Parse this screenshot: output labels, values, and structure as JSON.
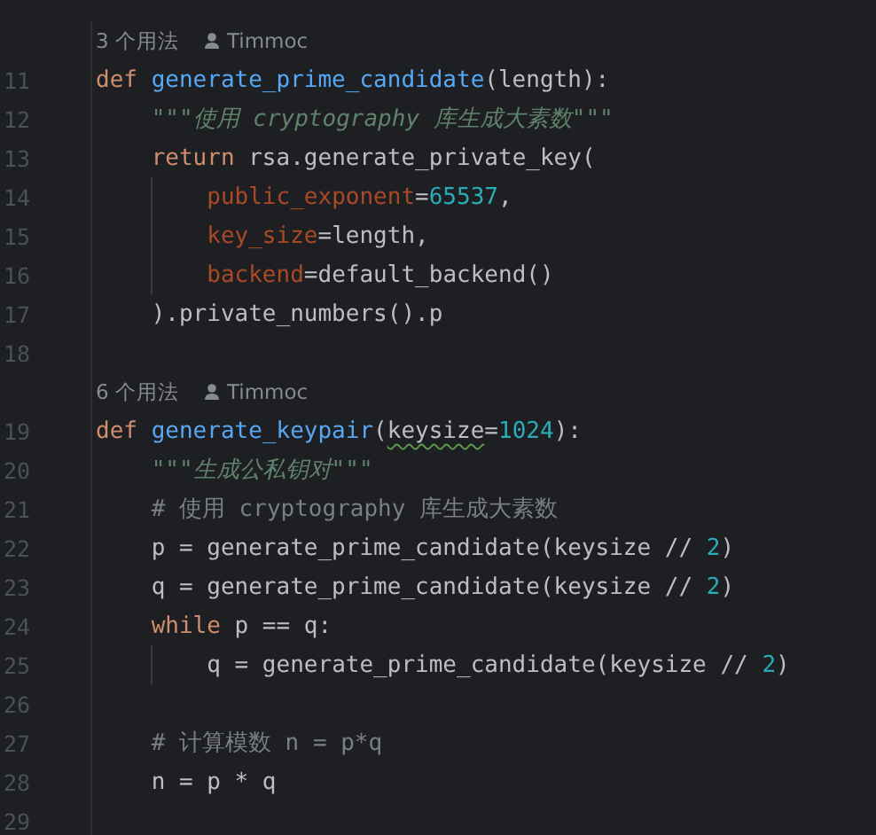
{
  "editor": {
    "rows": [
      {
        "kind": "hint",
        "usages": "3 个用法",
        "author": "Timmoc"
      },
      {
        "kind": "code",
        "number": "11",
        "tokens": [
          {
            "kind": "keyword",
            "text": "def "
          },
          {
            "kind": "function",
            "text": "generate_prime_candidate"
          },
          {
            "kind": "plain",
            "text": "(length):"
          }
        ]
      },
      {
        "kind": "code",
        "number": "12",
        "tokens": [
          {
            "kind": "docstring",
            "text": "    \"\"\"使用 cryptography 库生成大素数\"\"\""
          }
        ]
      },
      {
        "kind": "code",
        "number": "13",
        "tokens": [
          {
            "kind": "keyword",
            "text": "    return "
          },
          {
            "kind": "plain",
            "text": "rsa.generate_private_key("
          }
        ]
      },
      {
        "kind": "code",
        "number": "14",
        "tokens": [
          {
            "kind": "named-arg",
            "text": "        public_exponent"
          },
          {
            "kind": "plain",
            "text": "="
          },
          {
            "kind": "number",
            "text": "65537"
          },
          {
            "kind": "plain",
            "text": ","
          }
        ]
      },
      {
        "kind": "code",
        "number": "15",
        "tokens": [
          {
            "kind": "named-arg",
            "text": "        key_size"
          },
          {
            "kind": "plain",
            "text": "=length,"
          }
        ]
      },
      {
        "kind": "code",
        "number": "16",
        "tokens": [
          {
            "kind": "named-arg",
            "text": "        backend"
          },
          {
            "kind": "plain",
            "text": "=default_backend()"
          }
        ]
      },
      {
        "kind": "code",
        "number": "17",
        "tokens": [
          {
            "kind": "plain",
            "text": "    ).private_numbers().p"
          }
        ]
      },
      {
        "kind": "code",
        "number": "18",
        "tokens": []
      },
      {
        "kind": "hint",
        "usages": "6 个用法",
        "author": "Timmoc"
      },
      {
        "kind": "code",
        "number": "19",
        "tokens": [
          {
            "kind": "keyword",
            "text": "def "
          },
          {
            "kind": "function",
            "text": "generate_keypair"
          },
          {
            "kind": "plain",
            "text": "("
          },
          {
            "kind": "plain",
            "text": "keysize",
            "warning": true
          },
          {
            "kind": "plain",
            "text": "="
          },
          {
            "kind": "number",
            "text": "1024"
          },
          {
            "kind": "plain",
            "text": "):"
          }
        ]
      },
      {
        "kind": "code",
        "number": "20",
        "tokens": [
          {
            "kind": "docstring",
            "text": "    \"\"\"生成公私钥对\"\"\""
          }
        ]
      },
      {
        "kind": "code",
        "number": "21",
        "tokens": [
          {
            "kind": "comment",
            "text": "    # 使用 cryptography 库生成大素数"
          }
        ]
      },
      {
        "kind": "code",
        "number": "22",
        "tokens": [
          {
            "kind": "plain",
            "text": "    p = generate_prime_candidate(keysize // "
          },
          {
            "kind": "number",
            "text": "2"
          },
          {
            "kind": "plain",
            "text": ")"
          }
        ]
      },
      {
        "kind": "code",
        "number": "23",
        "tokens": [
          {
            "kind": "plain",
            "text": "    q = generate_prime_candidate(keysize // "
          },
          {
            "kind": "number",
            "text": "2"
          },
          {
            "kind": "plain",
            "text": ")"
          }
        ]
      },
      {
        "kind": "code",
        "number": "24",
        "tokens": [
          {
            "kind": "keyword",
            "text": "    while "
          },
          {
            "kind": "plain",
            "text": "p == q:"
          }
        ]
      },
      {
        "kind": "code",
        "number": "25",
        "tokens": [
          {
            "kind": "plain",
            "text": "        q = generate_prime_candidate(keysize // "
          },
          {
            "kind": "number",
            "text": "2"
          },
          {
            "kind": "plain",
            "text": ")"
          }
        ]
      },
      {
        "kind": "code",
        "number": "26",
        "tokens": []
      },
      {
        "kind": "code",
        "number": "27",
        "tokens": [
          {
            "kind": "comment",
            "text": "    # 计算模数 n = p*q"
          }
        ]
      },
      {
        "kind": "code",
        "number": "28",
        "tokens": [
          {
            "kind": "plain",
            "text": "    n = p * q"
          }
        ]
      },
      {
        "kind": "code",
        "number": "29",
        "tokens": []
      }
    ]
  }
}
